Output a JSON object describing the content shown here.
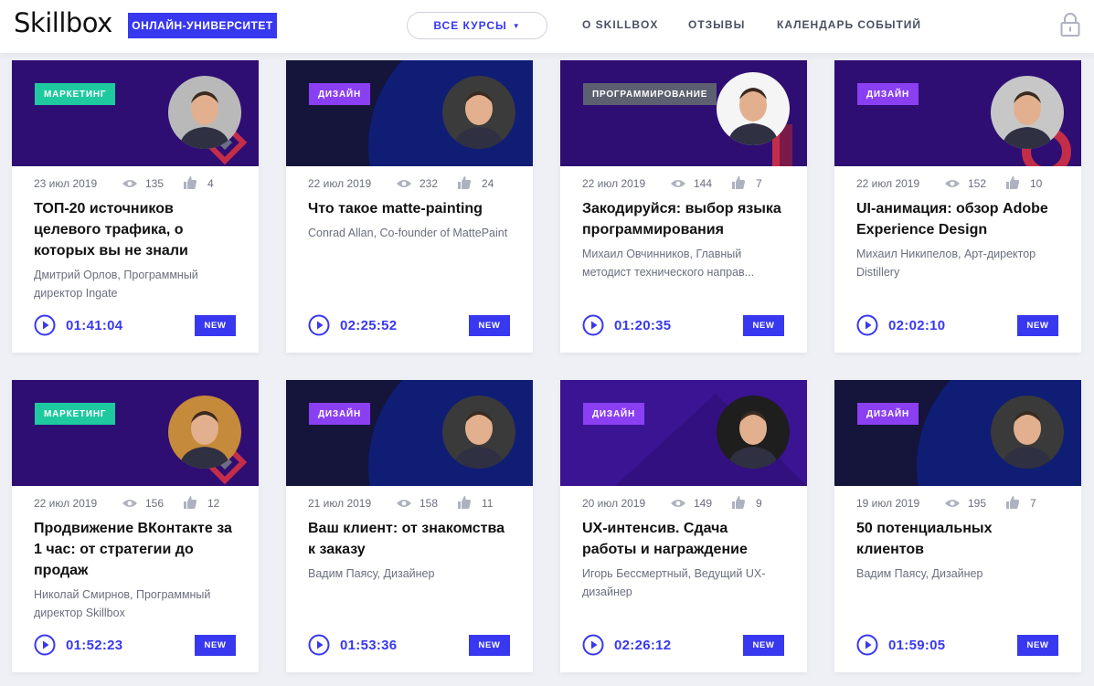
{
  "header": {
    "logo": "Skillbox",
    "university_badge": "ОНЛАЙН-УНИВЕРСИТЕТ",
    "courses_button": "ВСЕ КУРСЫ",
    "nav": [
      "О SKILLBOX",
      "ОТЗЫВЫ",
      "КАЛЕНДАРЬ СОБЫТИЙ"
    ],
    "lock_icon": "lock-icon"
  },
  "colors": {
    "accent": "#3838f0",
    "tag_marketing": "#1fc9a0",
    "tag_design": "#8b3ff2",
    "tag_programming": "#5d6070",
    "banner_purple": "#2e0e72",
    "banner_dark": "#15143a"
  },
  "cards": [
    {
      "tag": "МАРКЕТИНГ",
      "tag_type": "marketing",
      "date": "23 июл 2019",
      "views": "135",
      "likes": "4",
      "title": "ТОП-20 источников целевого трафика, о которых вы не знали",
      "author": "Дмитрий Орлов, Программный директор Ingate",
      "duration": "01:41:04",
      "badge": "NEW"
    },
    {
      "tag": "ДИЗАЙН",
      "tag_type": "design",
      "date": "22 июл 2019",
      "views": "232",
      "likes": "24",
      "title": "Что такое matte-painting",
      "author": "Conrad Allan, Co-founder of MattePaint",
      "duration": "02:25:52",
      "badge": "NEW"
    },
    {
      "tag": "ПРОГРАММИРОВАНИЕ",
      "tag_type": "programming",
      "date": "22 июл 2019",
      "views": "144",
      "likes": "7",
      "title": "Закодируйся: выбор языка программирования",
      "author": "Михаил Овчинников, Главный методист технического направ...",
      "duration": "01:20:35",
      "badge": "NEW"
    },
    {
      "tag": "ДИЗАЙН",
      "tag_type": "design",
      "date": "22 июл 2019",
      "views": "152",
      "likes": "10",
      "title": "UI-анимация: обзор Adobe Experience Design",
      "author": "Михаил Никипелов, Арт-директор Distillery",
      "duration": "02:02:10",
      "badge": "NEW"
    },
    {
      "tag": "МАРКЕТИНГ",
      "tag_type": "marketing",
      "date": "22 июл 2019",
      "views": "156",
      "likes": "12",
      "title": "Продвижение ВКонтакте за 1 час: от стратегии до продаж",
      "author": "Николай Смирнов, Программный директор Skillbox",
      "duration": "01:52:23",
      "badge": "NEW"
    },
    {
      "tag": "ДИЗАЙН",
      "tag_type": "design",
      "date": "21 июл 2019",
      "views": "158",
      "likes": "11",
      "title": "Ваш клиент: от знакомства к заказу",
      "author": "Вадим Паясу, Дизайнер",
      "duration": "01:53:36",
      "badge": "NEW"
    },
    {
      "tag": "ДИЗАЙН",
      "tag_type": "design",
      "date": "20 июл 2019",
      "views": "149",
      "likes": "9",
      "title": "UX-интенсив. Сдача работы и награждение",
      "author": "Игорь Бессмертный, Ведущий UX-дизайнер",
      "duration": "02:26:12",
      "badge": "NEW"
    },
    {
      "tag": "ДИЗАЙН",
      "tag_type": "design",
      "date": "19 июл 2019",
      "views": "195",
      "likes": "7",
      "title": "50 потенциальных клиентов",
      "author": "Вадим Паясу, Дизайнер",
      "duration": "01:59:05",
      "badge": "NEW"
    }
  ]
}
